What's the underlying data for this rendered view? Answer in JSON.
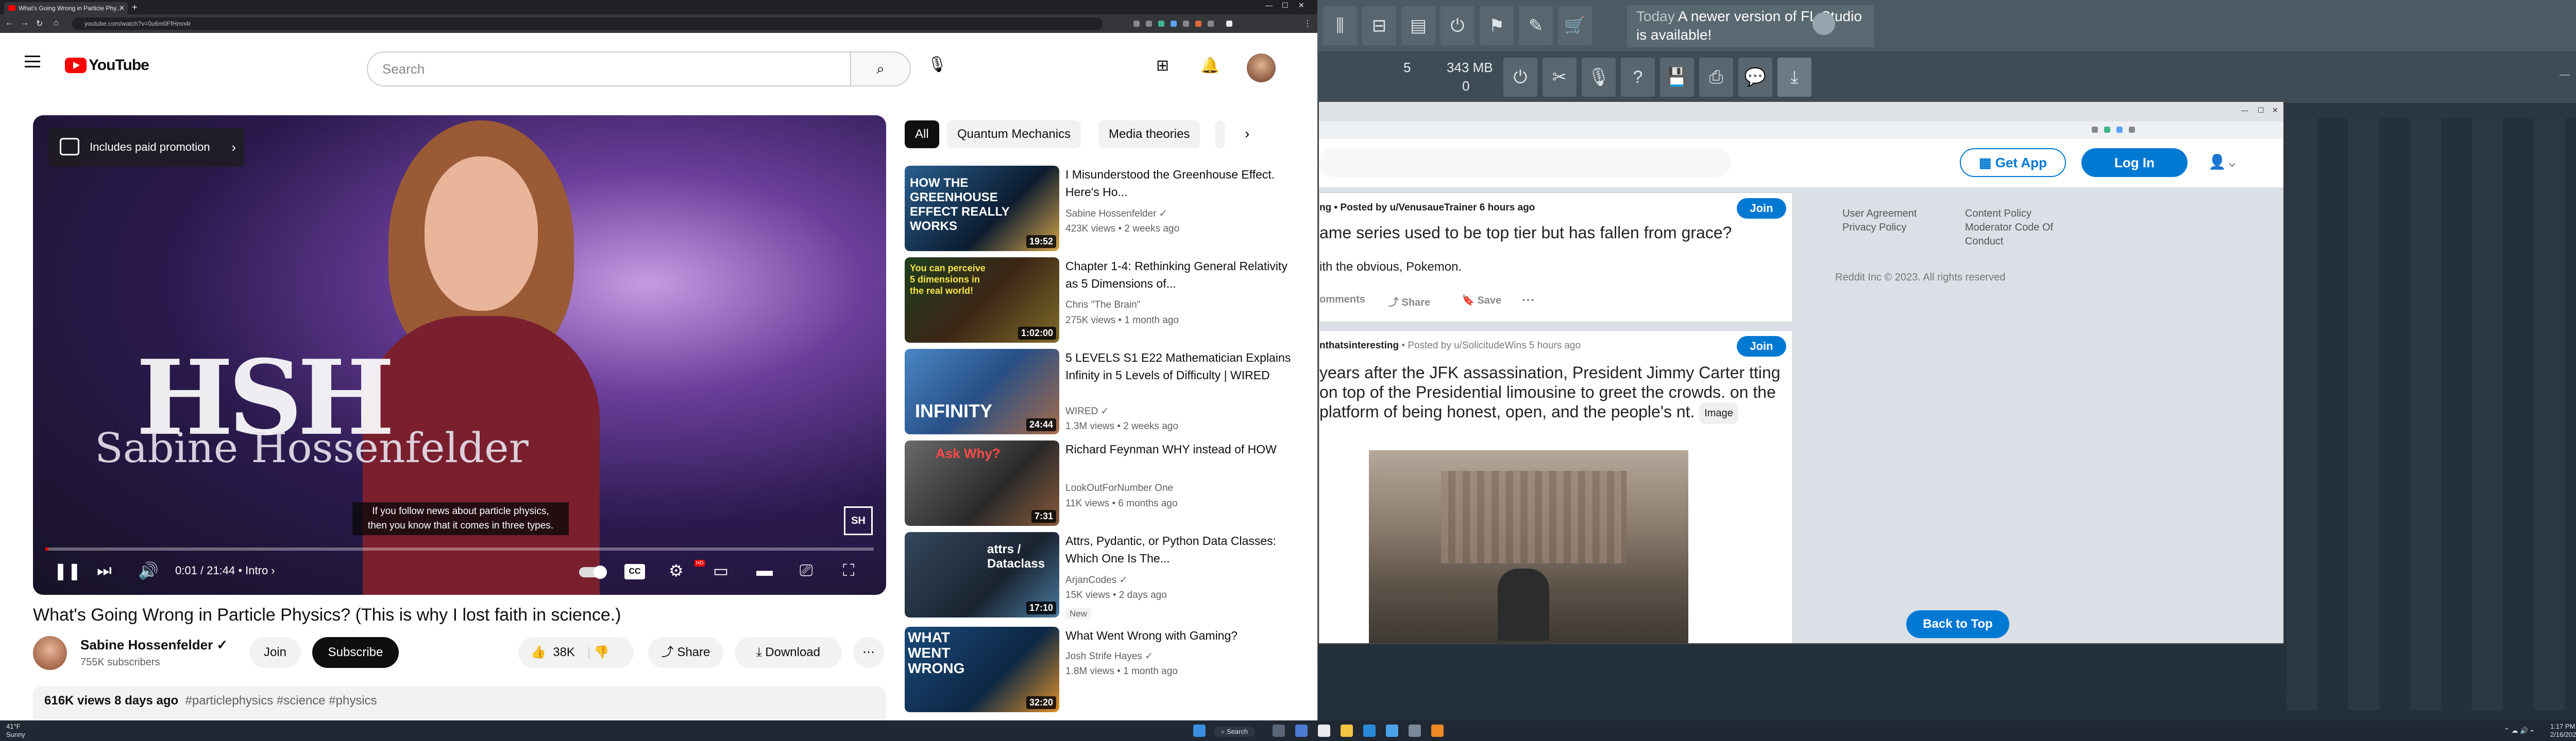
{
  "browser": {
    "tab_title": "What's Going Wrong in Particle Phy...",
    "url": "youtube.com/watch?v=0u6m0FfHmn4r"
  },
  "youtube": {
    "logo_text": "YouTube",
    "search_placeholder": "Search",
    "video": {
      "promo_text": "Includes paid promotion",
      "overlay_name": "Sabine Hossenfelder",
      "logo_mark": "HSH",
      "caption_line1": "If you follow news about particle physics,",
      "caption_line2": "then you know that it comes in three types.",
      "watermark": "SH",
      "time": "0:01 / 21:44",
      "chapter": "• Intro ›",
      "progress": 0.001
    },
    "title": "What's Going Wrong in Particle Physics? (This is why I lost faith in science.)",
    "channel": {
      "name": "Sabine Hossenfelder ✓",
      "subscribers": "755K subscribers"
    },
    "actions": {
      "join": "Join",
      "subscribe": "Subscribe",
      "likes": "38K",
      "share": "Share",
      "download": "Download"
    },
    "description": {
      "stats": "616K views  8 days ago",
      "tags": "#particlephysics #science #physics"
    },
    "chips": [
      "All",
      "Quantum Mechanics",
      "Media theories"
    ],
    "recommendations": [
      {
        "title": "I Misunderstood the Greenhouse Effect. Here's Ho...",
        "channel": "Sabine Hossenfelder ✓",
        "meta": "423K views • 2 weeks ago",
        "duration": "19:52",
        "thumb_text": "HOW THE GREENHOUSE EFFECT REALLY WORKS"
      },
      {
        "title": "Chapter 1-4: Rethinking General Relativity as 5 Dimensions of...",
        "channel": "Chris \"The Brain\"",
        "meta": "275K views • 1 month ago",
        "duration": "1:02:00",
        "thumb_text": "You can perceive 5 dimensions in the real world!"
      },
      {
        "title": "5 LEVELS  S1 E22 Mathematician Explains Infinity in 5 Levels of Difficulty | WIRED",
        "channel": "WIRED ✓",
        "meta": "1.3M views • 2 weeks ago",
        "duration": "24:44",
        "thumb_text": "INFINITY"
      },
      {
        "title": "Richard Feynman WHY instead of HOW",
        "channel": "LookOutForNumber One",
        "meta": "11K views • 6 months ago",
        "duration": "7:31",
        "thumb_text": "Ask Why?"
      },
      {
        "title": "Attrs, Pydantic, or Python Data Classes: Which One Is The...",
        "channel": "ArjanCodes ✓",
        "meta": "15K views • 2 days ago",
        "duration": "17:10",
        "thumb_text": "attrs / Dataclass",
        "badge": "New"
      },
      {
        "title": "What Went Wrong with Gaming?",
        "channel": "Josh Strife Hayes ✓",
        "meta": "1.8M views • 1 month ago",
        "duration": "32:20",
        "thumb_text": "WHAT WENT WRONG"
      }
    ]
  },
  "fl_studio": {
    "news_day": "Today",
    "news_text": "A newer version of FL Studio is available!",
    "pattern_num": "5",
    "memory": "343 MB",
    "zero": "0"
  },
  "reddit": {
    "get_app": "Get App",
    "login": "Log In",
    "post1": {
      "meta": "ng • Posted by u/VenusaueTrainer 6 hours ago",
      "title": "ame series used to be top tier but has fallen from grace?",
      "body": "ith the obvious, Pokemon.",
      "comments": "omments",
      "share": "Share",
      "save": "Save"
    },
    "post2": {
      "meta_sub": "nthatsinteresting",
      "meta": "• Posted by u/SolicitudeWins 5 hours ago",
      "title": "years after the JFK assassination, President Jimmy Carter tting on top of the Presidential limousine to greet the crowds. on the platform of being honest, open, and the people's nt.",
      "image_tag": "Image"
    },
    "join": "Join",
    "footer": {
      "user_agreement": "User Agreement",
      "privacy_policy": "Privacy Policy",
      "content_policy": "Content Policy",
      "moderator_code": "Moderator Code Of Conduct",
      "copyright": "Reddit Inc © 2023. All rights reserved"
    },
    "back_to_top": "Back to Top"
  },
  "taskbar": {
    "weather_temp": "41°F",
    "weather_desc": "Sunny",
    "search": "Search",
    "time": "1:17 PM",
    "date": "2/16/2023"
  }
}
